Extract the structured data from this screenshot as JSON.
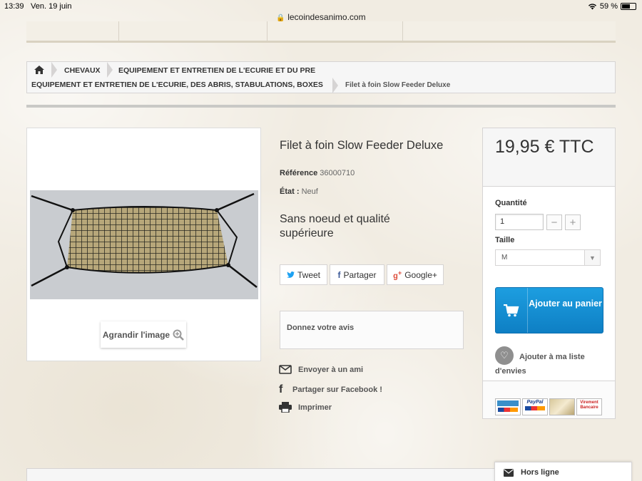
{
  "status_bar": {
    "time": "13:39",
    "date": "Ven. 19 juin",
    "battery": "59 %",
    "wifi_icon": "wifi-icon"
  },
  "browser": {
    "url": "lecoindesanimo.com",
    "lock_icon": "lock-icon"
  },
  "breadcrumb": {
    "home_icon": "home-icon",
    "items": [
      "CHEVAUX",
      "EQUIPEMENT ET ENTRETIEN DE L'ECURIE ET DU PRE",
      "EQUIPEMENT ET ENTRETIEN DE L'ECURIE, DES ABRIS, STABULATIONS, BOXES"
    ],
    "current": "Filet à foin Slow Feeder Deluxe"
  },
  "product": {
    "title": "Filet à foin Slow Feeder Deluxe",
    "reference_label": "Référence",
    "reference_value": "36000710",
    "state_label": "État :",
    "state_value": "Neuf",
    "short_description": "Sans noeud et qualité supérieure",
    "enlarge_label": "Agrandir l'image"
  },
  "social": {
    "tweet": "Tweet",
    "share": "Partager",
    "google": "Google+"
  },
  "review": {
    "label": "Donnez votre avis"
  },
  "actions": {
    "send_friend": "Envoyer à un ami",
    "share_facebook": "Partager sur Facebook !",
    "print": "Imprimer"
  },
  "buy_box": {
    "price": "19,95 € TTC",
    "quantity_label": "Quantité",
    "quantity_value": "1",
    "size_label": "Taille",
    "size_value": "M",
    "add_to_cart": "Ajouter au panier",
    "wishlist": "Ajouter à ma liste d'envies"
  },
  "payment_logos": [
    "PayPal",
    "Virement Bancaire"
  ],
  "chat": {
    "label": "Hors ligne"
  },
  "colors": {
    "cart_button": "#1589d0",
    "background": "#f1ece2"
  }
}
